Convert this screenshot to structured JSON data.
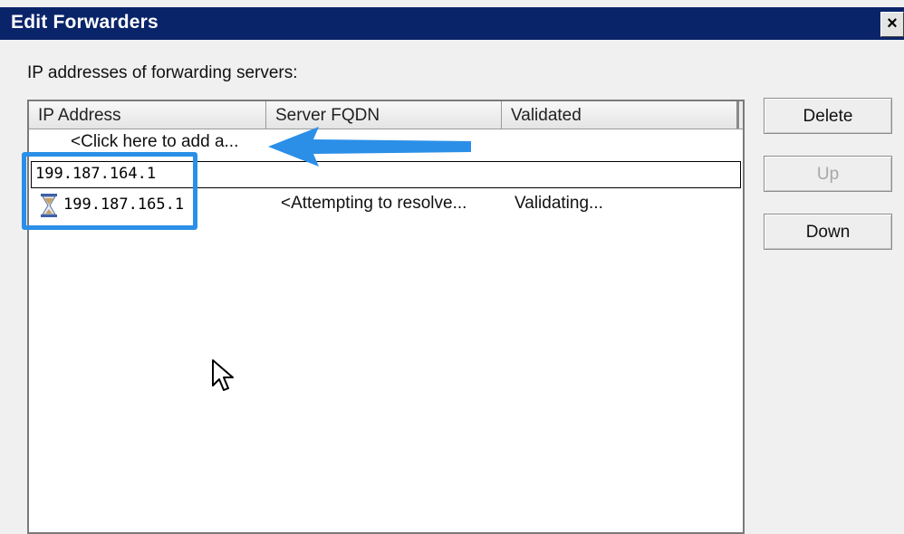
{
  "window": {
    "title": "Edit Forwarders",
    "close_label": "×"
  },
  "section_label": "IP addresses of forwarding servers:",
  "list": {
    "columns": [
      "IP Address",
      "Server FQDN",
      "Validated"
    ],
    "add_row_text": "<Click here to add a...",
    "editing_value": "199.187.164.1",
    "entries": [
      {
        "icon": "hourglass-icon",
        "ip": "199.187.165.1",
        "fqdn": "<Attempting to resolve...",
        "validated": "Validating..."
      }
    ]
  },
  "buttons": {
    "delete": "Delete",
    "up": "Up",
    "down": "Down"
  },
  "colors": {
    "titlebar": "#0a246a",
    "annotation_blue": "#2b8fe8"
  }
}
